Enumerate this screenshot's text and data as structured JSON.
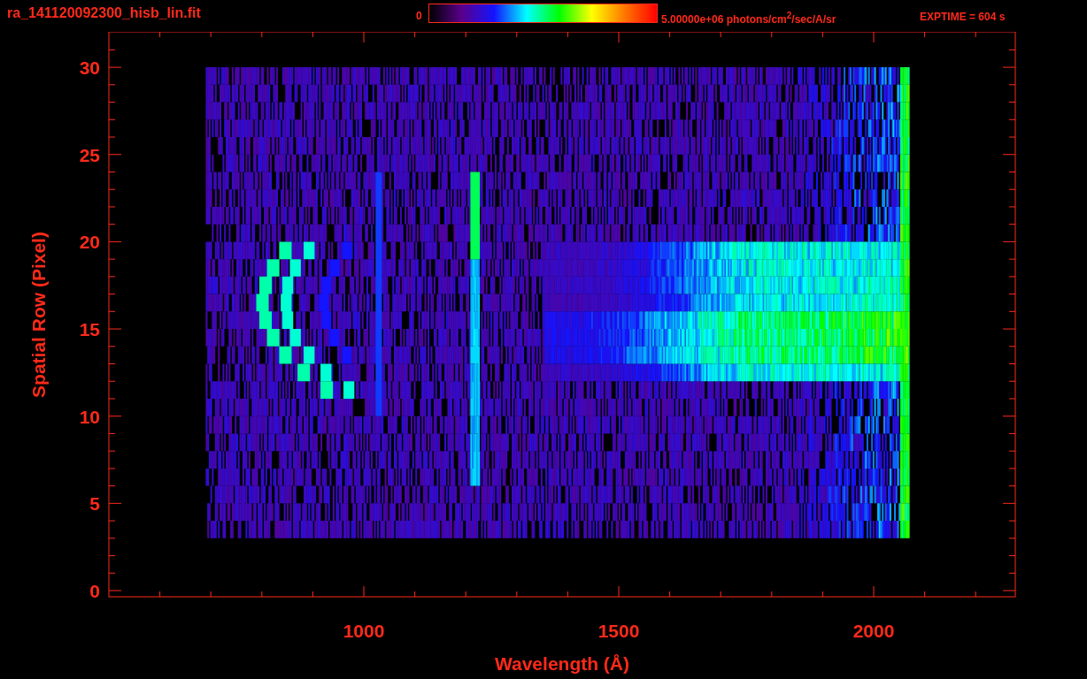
{
  "title": "ra_141120092300_hisb_lin.fit",
  "colorbar": {
    "min_label": "0",
    "max_label": "5.00000e+06 photons/cm$^{2}$/sec/A/sr"
  },
  "exposure": "EXPTIME = 604 s",
  "plot": {
    "xlabel": "Wavelength (Å)",
    "ylabel": "Spatial Row (Pixel)",
    "x_ticks": [
      "1000",
      "1500",
      "2000"
    ],
    "y_ticks": [
      "30",
      "25",
      "20",
      "15",
      "10",
      "5",
      "0"
    ]
  }
}
